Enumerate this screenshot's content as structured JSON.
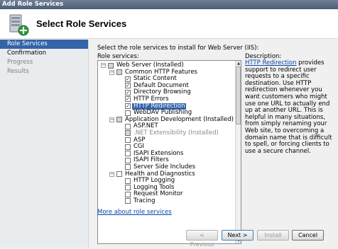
{
  "window": {
    "title": "Add Role Services"
  },
  "header": {
    "title": "Select Role Services"
  },
  "sidebar": {
    "items": [
      "Role Services",
      "Confirmation",
      "Progress",
      "Results"
    ]
  },
  "main": {
    "instructions": "Select the role services to install for Web Server (IIS):",
    "roles_label": "Role services:",
    "description_label": "Description:",
    "description_link": "HTTP Redirection",
    "description_body": " provides support to redirect user requests to a specific destination. Use HTTP redirection whenever you want customers who might use one URL to actually end up at another URL. This is helpful in many situations, from simply renaming your Web site, to overcoming a domain name that is difficult to spell, or forcing clients to use a secure channel.",
    "more_link": "More about role services",
    "tree": [
      {
        "label": "Web Server  (Installed)",
        "state": "grey",
        "expander": "-"
      },
      {
        "label": "Common HTTP Features",
        "state": "grey",
        "expander": "-"
      },
      {
        "label": "Static Content",
        "state": "checked"
      },
      {
        "label": "Default Document",
        "state": "checked"
      },
      {
        "label": "Directory Browsing",
        "state": "checked"
      },
      {
        "label": "HTTP Errors",
        "state": "checked"
      },
      {
        "label": "HTTP Redirection",
        "state": "checked"
      },
      {
        "label": "WebDAV Publishing",
        "state": "unchecked"
      },
      {
        "label": "Application Development  (Installed)",
        "state": "grey",
        "expander": "-"
      },
      {
        "label": "ASP.NET",
        "state": "unchecked"
      },
      {
        "label": ".NET Extensibility  (Installed)",
        "state": "grey"
      },
      {
        "label": "ASP",
        "state": "unchecked"
      },
      {
        "label": "CGI",
        "state": "unchecked"
      },
      {
        "label": "ISAPI Extensions",
        "state": "unchecked"
      },
      {
        "label": "ISAPI Filters",
        "state": "unchecked"
      },
      {
        "label": "Server Side Includes",
        "state": "unchecked"
      },
      {
        "label": "Health and Diagnostics",
        "state": "unchecked",
        "expander": "-"
      },
      {
        "label": "HTTP Logging",
        "state": "unchecked"
      },
      {
        "label": "Logging Tools",
        "state": "unchecked"
      },
      {
        "label": "Request Monitor",
        "state": "unchecked"
      },
      {
        "label": "Tracing",
        "state": "unchecked"
      }
    ]
  },
  "buttons": {
    "previous": "< Previous",
    "next": "Next >",
    "install": "Install",
    "cancel": "Cancel"
  },
  "icons": {
    "header": "server-add-icon",
    "check": "checkmark-icon"
  },
  "colors": {
    "selection": "#3464a8",
    "link": "#0645ad"
  }
}
